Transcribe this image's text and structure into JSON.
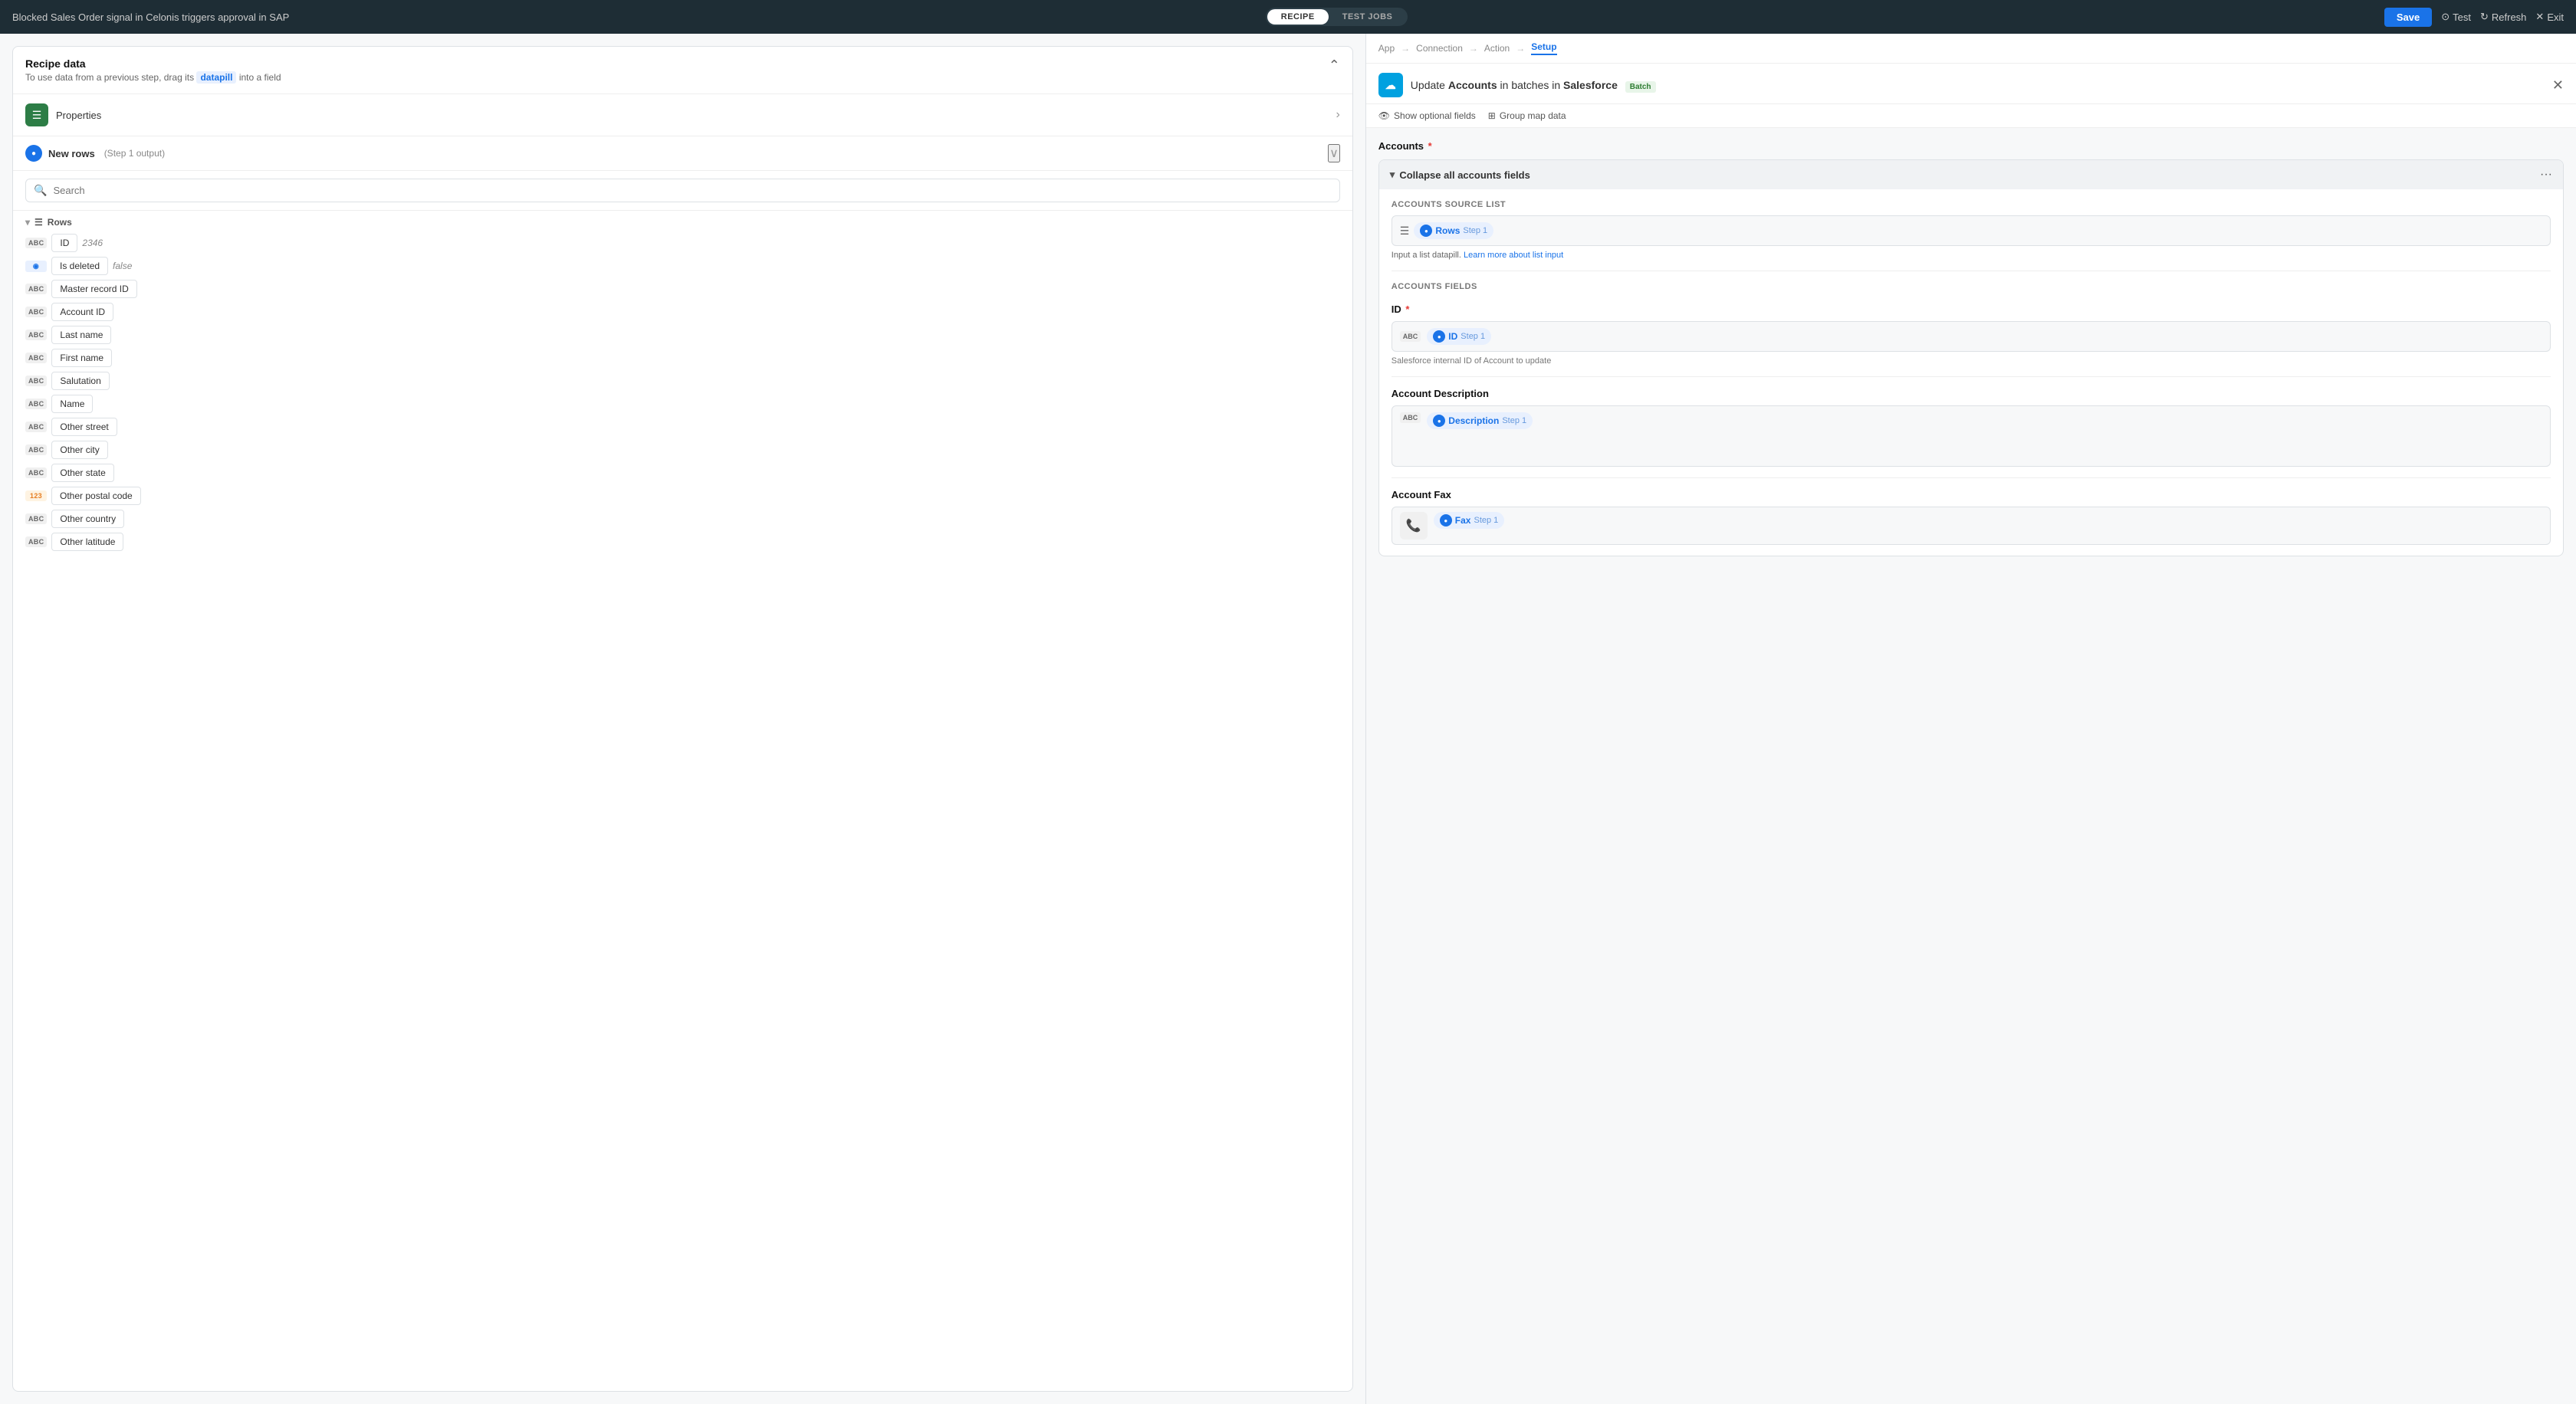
{
  "window": {
    "title": "Blocked Sales Order signal in Celonis triggers approval in SAP"
  },
  "tabs": {
    "recipe": "RECIPE",
    "test_jobs": "TEST JOBS",
    "active": "recipe"
  },
  "header_actions": {
    "save": "Save",
    "test": "Test",
    "refresh": "Refresh",
    "exit": "Exit"
  },
  "left_panel": {
    "recipe_data": {
      "title": "Recipe data",
      "subtitle_pre": "To use data from a previous step, drag its",
      "datapill": "datapill",
      "subtitle_post": "into a field"
    },
    "properties": {
      "label": "Properties",
      "icon": "☰"
    },
    "new_rows": {
      "label": "New rows",
      "step": "(Step 1 output)"
    },
    "search": {
      "placeholder": "Search"
    },
    "rows_section": {
      "label": "Rows",
      "items": [
        {
          "type": "ABC",
          "label": "ID",
          "value": "2346",
          "type_variant": "abc"
        },
        {
          "type": "◉",
          "label": "Is deleted",
          "value": "false",
          "type_variant": "toggle"
        },
        {
          "type": "ABC",
          "label": "Master record ID",
          "value": "",
          "type_variant": "abc"
        },
        {
          "type": "ABC",
          "label": "Account ID",
          "value": "",
          "type_variant": "abc"
        },
        {
          "type": "ABC",
          "label": "Last name",
          "value": "",
          "type_variant": "abc"
        },
        {
          "type": "ABC",
          "label": "First name",
          "value": "",
          "type_variant": "abc"
        },
        {
          "type": "ABC",
          "label": "Salutation",
          "value": "",
          "type_variant": "abc"
        },
        {
          "type": "ABC",
          "label": "Name",
          "value": "",
          "type_variant": "abc"
        },
        {
          "type": "ABC",
          "label": "Other street",
          "value": "",
          "type_variant": "abc"
        },
        {
          "type": "ABC",
          "label": "Other city",
          "value": "",
          "type_variant": "abc"
        },
        {
          "type": "ABC",
          "label": "Other state",
          "value": "",
          "type_variant": "abc"
        },
        {
          "type": "123",
          "label": "Other postal code",
          "value": "",
          "type_variant": "num"
        },
        {
          "type": "ABC",
          "label": "Other country",
          "value": "",
          "type_variant": "abc"
        },
        {
          "type": "ABC",
          "label": "Other latitude",
          "value": "",
          "type_variant": "abc"
        }
      ]
    }
  },
  "right_panel": {
    "breadcrumb": {
      "items": [
        "App",
        "Connection",
        "Action",
        "Setup"
      ],
      "active": "Setup"
    },
    "title": {
      "action_pre": "Update",
      "action_subject": "Accounts",
      "action_mid": "in batches in",
      "app_name": "Salesforce",
      "badge": "Batch"
    },
    "toolbar": {
      "show_optional": "Show optional fields",
      "group_map": "Group map data"
    },
    "accounts_section": {
      "label": "Accounts",
      "required": true,
      "card": {
        "header": "Collapse all accounts fields",
        "source_list": {
          "label": "Accounts source list",
          "chip_icon": "☰",
          "chip_label": "Rows",
          "chip_step": "Step 1",
          "help_pre": "Input a list datapill.",
          "help_link": "Learn more about list input"
        },
        "fields_label": "Accounts fields",
        "id_field": {
          "label": "ID",
          "required": true,
          "chip_type": "ABC",
          "chip_label": "ID",
          "chip_step": "Step 1",
          "hint": "Salesforce internal ID of Account to update"
        },
        "description_field": {
          "label": "Account Description",
          "chip_type": "ABC",
          "chip_label": "Description",
          "chip_step": "Step 1"
        },
        "fax_field": {
          "label": "Account Fax",
          "chip_label": "Fax",
          "chip_step": "Step 1"
        }
      }
    }
  }
}
